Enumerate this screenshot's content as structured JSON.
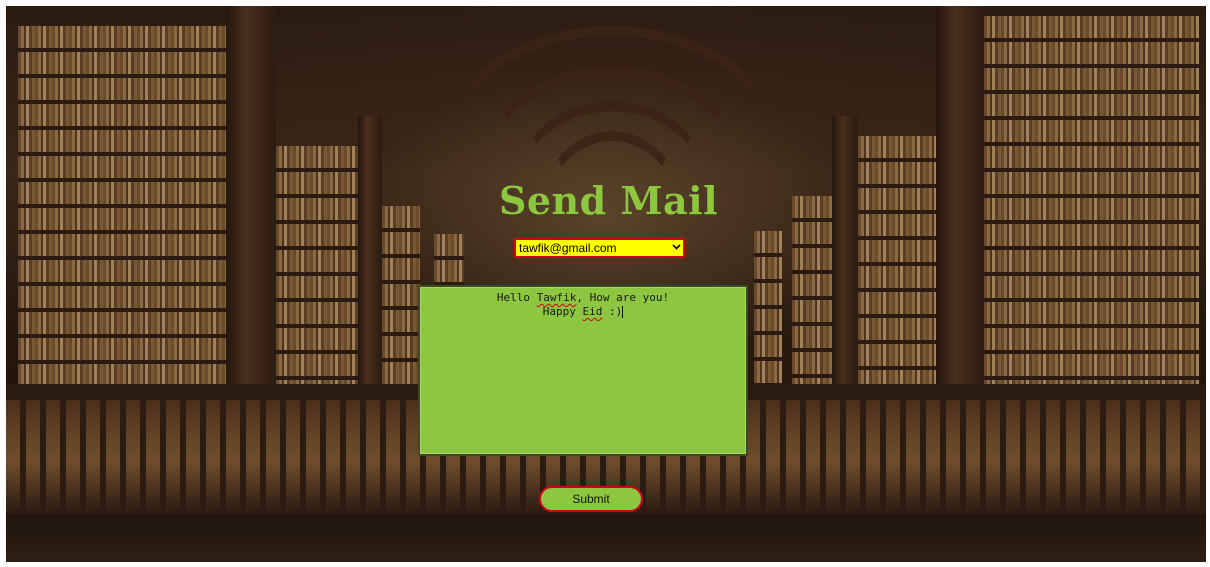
{
  "page": {
    "title": "Send Mail"
  },
  "form": {
    "recipient_select": {
      "selected": "tawfik@gmail.com"
    },
    "message": {
      "line1_prefix": "Hello ",
      "line1_name": "Tawfik",
      "line1_suffix": ", How are you!",
      "line2_prefix": "Happy ",
      "line2_word": "Eid",
      "line2_suffix": " :)"
    },
    "submit_label": "Submit"
  },
  "colors": {
    "accent_green": "#8dc63f",
    "select_bg": "#ffff00",
    "border_red": "#d0021b"
  }
}
